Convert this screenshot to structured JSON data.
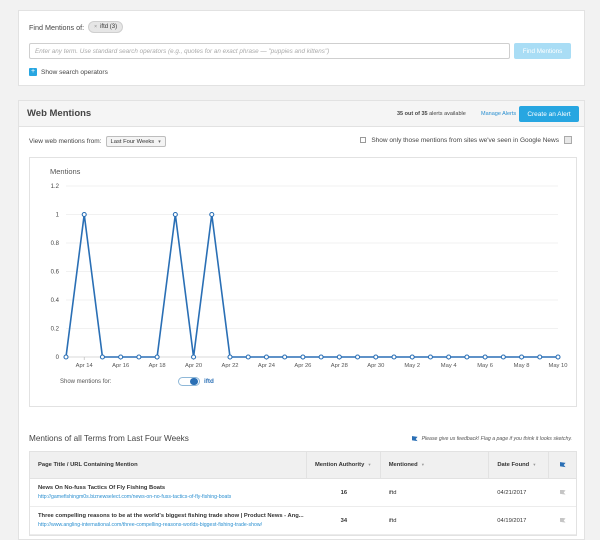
{
  "search": {
    "find_label": "Find Mentions of:",
    "term_pill": "iftd (3)",
    "pill_remove": "×",
    "placeholder": "Enter any term. Use standard search operators (e.g., quotes for an exact phrase — \"puppies and kittens\")",
    "find_button": "Find Mentions",
    "operators_toggle_icon": "+",
    "operators_label": "Show search operators"
  },
  "mentions": {
    "title": "Web Mentions",
    "alerts_count": "35 out of 35",
    "alerts_suffix": "alerts available",
    "manage_alerts": "Manage Alerts",
    "create_alert": "Create an Alert",
    "view_label": "View web mentions from:",
    "range_selected": "Last Four Weeks",
    "range_caret": "▾",
    "gnews_label": "Show only those mentions from sites we've seen in Google News",
    "show_mentions_label": "Show mentions for:",
    "show_term": "iftd"
  },
  "colors": {
    "accent": "#27a6e1",
    "line": "#2a6fb5",
    "link": "#2a8fd0"
  },
  "chart_data": {
    "type": "line",
    "ylabel": "Mentions",
    "ylim": [
      0,
      1.2
    ],
    "yticks": [
      "0",
      "0.2",
      "0.4",
      "0.6",
      "0.8",
      "1",
      "1.2"
    ],
    "xticks": [
      "Apr 14",
      "Apr 16",
      "Apr 18",
      "Apr 20",
      "Apr 22",
      "Apr 24",
      "Apr 26",
      "Apr 28",
      "Apr 30",
      "May 2",
      "May 4",
      "May 6",
      "May 8",
      "May 10"
    ],
    "x": [
      "Apr 13",
      "Apr 14",
      "Apr 15",
      "Apr 16",
      "Apr 17",
      "Apr 18",
      "Apr 19",
      "Apr 20",
      "Apr 21",
      "Apr 22",
      "Apr 23",
      "Apr 24",
      "Apr 25",
      "Apr 26",
      "Apr 27",
      "Apr 28",
      "Apr 29",
      "Apr 30",
      "May 1",
      "May 2",
      "May 3",
      "May 4",
      "May 5",
      "May 6",
      "May 7",
      "May 8",
      "May 9",
      "May 10"
    ],
    "series": [
      {
        "values": [
          0,
          1,
          0,
          0,
          0,
          0,
          1,
          0,
          1,
          0,
          0,
          0,
          0,
          0,
          0,
          0,
          0,
          0,
          0,
          0,
          0,
          0,
          0,
          0,
          0,
          0,
          0,
          0
        ]
      }
    ],
    "grid": true
  },
  "table": {
    "title": "Mentions of all Terms from Last Four Weeks",
    "feedback": "Please give us feedback! Flag a page if you think it looks sketchy.",
    "columns": [
      "Page Title / URL Containing Mention",
      "Mention Authority",
      "Mentioned",
      "Date Found"
    ],
    "sort_glyph": "▾",
    "rows": [
      {
        "title": "News On No-fuss Tactics Of Fly Fishing Boats",
        "url": "http://gamefishingm0s.biznewselect.com/news-on-no-fuss-tactics-of-fly-fishing-boats",
        "authority": "16",
        "mentioned": "iftd",
        "date": "04/21/2017"
      },
      {
        "title": "Three compelling reasons to be at the world's biggest fishing trade show | Product News - Ang...",
        "url": "http://www.angling-international.com/three-compelling-reasons-worlds-biggest-fishing-trade-show/",
        "authority": "34",
        "mentioned": "iftd",
        "date": "04/19/2017"
      }
    ]
  }
}
